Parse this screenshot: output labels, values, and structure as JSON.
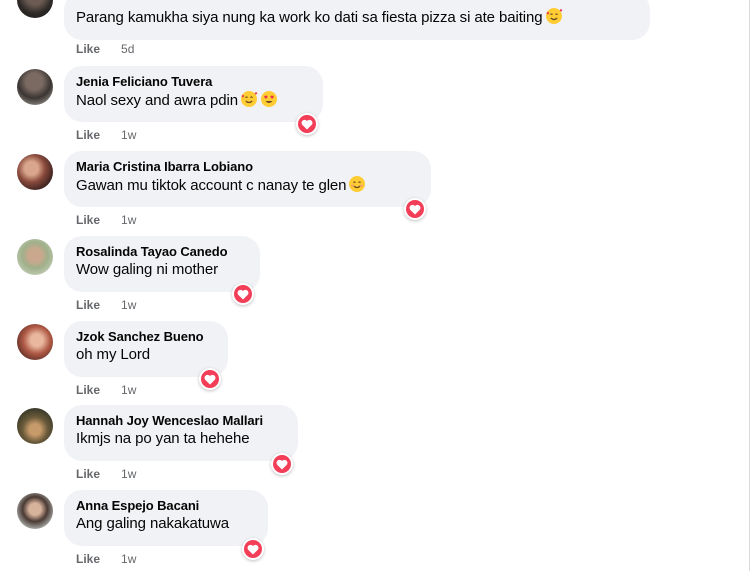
{
  "like_label": "Like",
  "colors": {
    "bubble": "#f0f2f5",
    "heart": "#f33e58",
    "meta": "#65676b",
    "text": "#050505"
  },
  "comments": [
    {
      "author": "",
      "text": "Parang kamukha siya nung ka work ko dati sa fiesta pizza si ate baiting",
      "emoji": [
        "smiling-face-with-hearts"
      ],
      "time": "5d",
      "reaction": null
    },
    {
      "author": "Jenia Feliciano Tuvera",
      "text": "Naol sexy and awra pdin",
      "emoji": [
        "smiling-face-with-hearts",
        "heart-eyes"
      ],
      "time": "1w",
      "reaction": "heart-icon"
    },
    {
      "author": "Maria Cristina Ibarra Lobiano",
      "text": "Gawan mu tiktok account c nanay te glen",
      "emoji": [
        "smiling-face"
      ],
      "time": "1w",
      "reaction": "heart-icon"
    },
    {
      "author": "Rosalinda Tayao Canedo",
      "text": "Wow galing ni mother",
      "emoji": [],
      "time": "1w",
      "reaction": "heart-icon"
    },
    {
      "author": "Jzok Sanchez Bueno",
      "text": "oh my Lord",
      "emoji": [],
      "time": "1w",
      "reaction": "heart-icon"
    },
    {
      "author": "Hannah Joy Wenceslao Mallari",
      "text": "Ikmjs na po yan ta hehehe",
      "emoji": [],
      "time": "1w",
      "reaction": "heart-icon"
    },
    {
      "author": "Anna Espejo Bacani",
      "text": "Ang galing nakakatuwa",
      "emoji": [],
      "time": "1w",
      "reaction": "heart-icon"
    }
  ]
}
